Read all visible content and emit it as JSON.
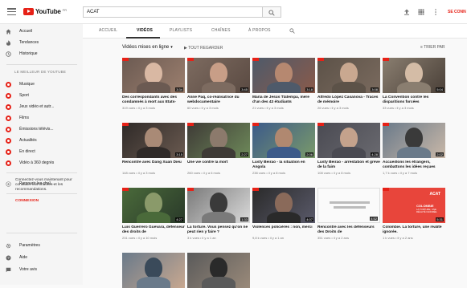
{
  "header": {
    "search_value": "ACAT",
    "logo_text": "YouTube",
    "logo_region": "FR",
    "signin_label": "SE CONN"
  },
  "sidebar": {
    "main": [
      {
        "label": "Accueil",
        "icon": "home-icon"
      },
      {
        "label": "Tendances",
        "icon": "flame-icon"
      },
      {
        "label": "Historique",
        "icon": "history-icon"
      }
    ],
    "best_of_heading": "LE MEILLEUR DE YOUTUBE",
    "best_of": [
      {
        "label": "Musique",
        "icon": "music-icon"
      },
      {
        "label": "Sport",
        "icon": "sport-icon"
      },
      {
        "label": "Jeux vidéo et autr...",
        "icon": "gaming-icon"
      },
      {
        "label": "Films",
        "icon": "film-icon"
      },
      {
        "label": "Émissions télévis...",
        "icon": "tv-icon"
      },
      {
        "label": "Actualités",
        "icon": "news-icon"
      },
      {
        "label": "En direct",
        "icon": "live-icon"
      },
      {
        "label": "Vidéo à 360 degrés",
        "icon": "360-icon"
      }
    ],
    "browse_channels": "Parcourir les chaî...",
    "promo_text": "Connectez-vous maintenant pour consulter vos chaînes et les recommandations.",
    "promo_link": "CONNEXION",
    "footer": [
      {
        "label": "Paramètres",
        "icon": "gear-icon"
      },
      {
        "label": "Aide",
        "icon": "help-icon"
      },
      {
        "label": "Votre avis",
        "icon": "feedback-icon"
      }
    ]
  },
  "tabs": [
    "ACCUEIL",
    "VIDÉOS",
    "PLAYLISTS",
    "CHAÎNES",
    "À PROPOS"
  ],
  "active_tab_index": 1,
  "section": {
    "title": "Vidéos mises en ligne",
    "play_all": "TOUT REGARDER",
    "sort_by": "TRIER PAR"
  },
  "videos": [
    {
      "title": "Des correspondants avec des condamnés à mort aux Etats-",
      "meta": "319 vues • il y a 3 mois",
      "duration": "3:34"
    },
    {
      "title": "Anne Paq, co-réalisatrice du webdocumentaire",
      "meta": "60 vues • il y a 3 mois",
      "duration": "3:45"
    },
    {
      "title": "María de Jesús Tlatempa, mère d'un des 43 étudiants",
      "meta": "21 vues • il y a 3 mois",
      "duration": "3:18"
    },
    {
      "title": "Alfredo López Casanova - Traces de mémoire",
      "meta": "26 vues • il y a 3 mois",
      "duration": "3:08"
    },
    {
      "title": "La Convention contre les disparitions forcées",
      "meta": "33 vues • il y a 3 mois",
      "duration": "5:04"
    },
    {
      "title": "Rencontre avec Dang Xuan Dieu",
      "meta": "148 vues • il y a 3 mois",
      "duration": "3:15"
    },
    {
      "title": "Une vie contre la mort",
      "meta": "260 vues • il y a 6 mois",
      "duration": "2:27"
    },
    {
      "title": "Lusty Beirao - la situation en Angola",
      "meta": "238 vues • il y a 8 mois",
      "duration": "2:06"
    },
    {
      "title": "Lusty Beirao - arrestation et grève de la faim",
      "meta": "108 vues • il y a 8 mois",
      "duration": "4:28"
    },
    {
      "title": "Accueillons les étrangers, combattons les idées reçues",
      "meta": "1,7 k vues • il y a 7 mois",
      "duration": "2:02"
    },
    {
      "title": "Luis Guerrero Guevara, défenseur des droits de",
      "meta": "231 vues • il y a 10 mois",
      "duration": "4:27"
    },
    {
      "title": "La torture. Vous pensez qu'on ne peut rien y faire ?",
      "meta": "3 k vues • il y a 1 an",
      "duration": "1:33"
    },
    {
      "title": "Violences policières : non, merci",
      "meta": "9,8 k vues • il y a 1 an",
      "duration": "4:07"
    },
    {
      "title": "Rencontre avec les défenseurs des Droits de",
      "meta": "351 vues • il y a 2 ans",
      "duration": "4:52"
    },
    {
      "title": "Colombie. La torture, une réalité ignorée.",
      "meta": "1 k vues • il y a 2 ans",
      "duration": "5:31"
    },
    {
      "title": "",
      "meta": "",
      "duration": ""
    },
    {
      "title": "",
      "meta": "",
      "duration": ""
    }
  ],
  "thumb_overlay": {
    "acat_logo": "ACAT",
    "colombie_text": "COLOMBIE",
    "colombie_sub": "LA TORTURE, UNE RÉALITÉ IGNORÉE"
  },
  "colors": {
    "brand_red": "#e62117",
    "acat_red": "#e8453b"
  }
}
